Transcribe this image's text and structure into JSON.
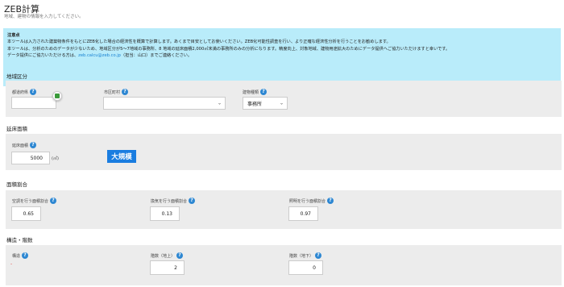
{
  "header": {
    "title": "ZEB計算",
    "subtitle": "地域、建物の情報を入力してください。"
  },
  "notice": {
    "heading": "注意点",
    "line1": "本ツールは入力された建築物条件をもとにZEB化した場合の経済性を概算で計算します。あくまで目安としてお使いください。ZEB化可能性調査を行い、より正確な経済性分析を行うことをお勧めします。",
    "line2": "本ツールは、分析のためのデータが少ないため、地域区分が5〜7地域の事務所、8 地域の延床面積2,000㎡未満の事務所のみの分析になります。精度向上、対象地域、建物用途拡大のためにデータ提供へご協力いただけますと幸いです。",
    "line3_prefix": "データ提供にご協力いただける方は、",
    "email": "zeb.calcu@zeb.co.jp",
    "line3_suffix": "（担当：山口）までご連絡ください。"
  },
  "region_section": {
    "title": "地域区分",
    "prefecture_label": "都道府県",
    "prefecture_value": "",
    "city_label": "市区町村",
    "city_value": "",
    "building_type_label": "建物種類",
    "building_type_value": "事務所"
  },
  "area_section": {
    "title": "延床面積",
    "floor_area_label": "延床面積",
    "floor_area_value": "5000",
    "unit": "(㎡)",
    "scale_badge": "大規模"
  },
  "ratio_section": {
    "title": "面積割合",
    "ac_label": "空調を行う面積割合",
    "ac_value": "0.65",
    "ventilation_label": "換気を行う面積割合",
    "ventilation_value": "0.13",
    "lighting_label": "照明を行う面積割合",
    "lighting_value": "0.97"
  },
  "structure_section": {
    "title": "構造・階数",
    "structure_label": "構造",
    "structure_value": "-",
    "floors_above_label": "階数（地上）",
    "floors_above_value": "2",
    "floors_below_label": "階数（地下）",
    "floors_below_value": "0"
  },
  "colors": {
    "accent": "#1a7de0",
    "notice_bg": "#b9ecfa",
    "panel_bg": "#ececec"
  },
  "icons": {
    "help": "question-icon",
    "map": "map-icon",
    "dropdown": "chevron-down-icon"
  },
  "help_glyph": "?",
  "caret_glyph": "⌄"
}
